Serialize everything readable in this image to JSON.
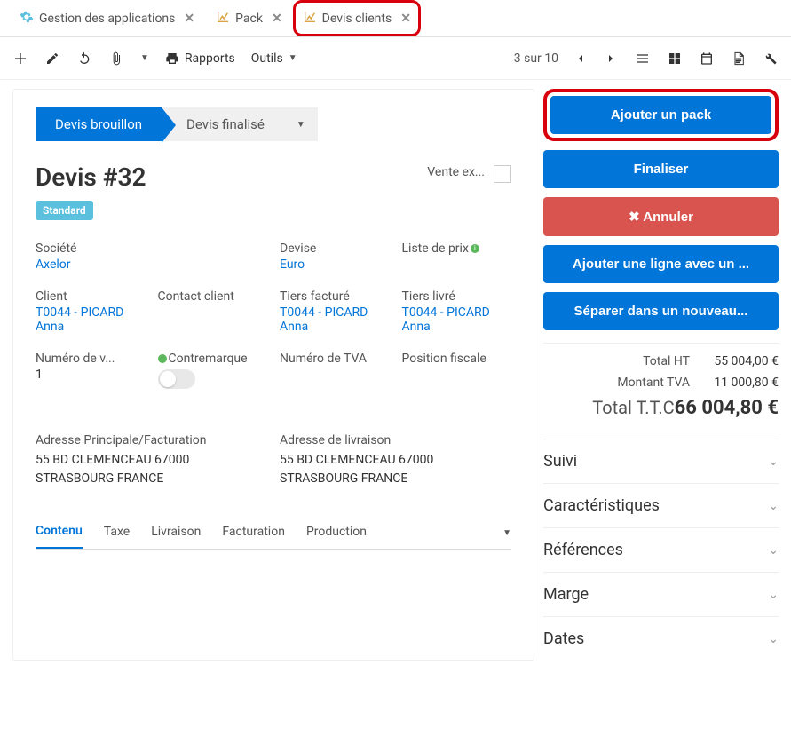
{
  "tabs": [
    {
      "label": "Gestion des applications",
      "icon": "gear"
    },
    {
      "label": "Pack",
      "icon": "chart"
    },
    {
      "label": "Devis clients",
      "icon": "chart",
      "highlighted": true
    }
  ],
  "toolbar": {
    "reports": "Rapports",
    "tools": "Outils",
    "pager": "3 sur 10"
  },
  "status": {
    "active": "Devis brouillon",
    "next": "Devis finalisé"
  },
  "title": "Devis #32",
  "badge": "Standard",
  "vente_ex": "Vente ex...",
  "fields": {
    "societe": {
      "label": "Société",
      "value": "Axelor"
    },
    "devise": {
      "label": "Devise",
      "value": "Euro"
    },
    "liste_prix": {
      "label": "Liste de prix"
    },
    "client": {
      "label": "Client",
      "value": "T0044 - PICARD Anna"
    },
    "contact_client": {
      "label": "Contact client"
    },
    "tiers_facture": {
      "label": "Tiers facturé",
      "value": "T0044 - PICARD Anna"
    },
    "tiers_livre": {
      "label": "Tiers livré",
      "value": "T0044 - PICARD Anna"
    },
    "numero_v": {
      "label": "Numéro de v...",
      "value": "1"
    },
    "contremarque": {
      "label": "Contremarque"
    },
    "numero_tva": {
      "label": "Numéro de TVA"
    },
    "position_fiscale": {
      "label": "Position fiscale"
    }
  },
  "addresses": {
    "facturation": {
      "label": "Adresse Principale/Facturation",
      "line1": "55 BD CLEMENCEAU 67000",
      "line2": "STRASBOURG FRANCE"
    },
    "livraison": {
      "label": "Adresse de livraison",
      "line1": "55 BD CLEMENCEAU 67000",
      "line2": "STRASBOURG FRANCE"
    }
  },
  "sub_tabs": [
    "Contenu",
    "Taxe",
    "Livraison",
    "Facturation",
    "Production"
  ],
  "actions": {
    "ajouter_pack": "Ajouter un pack",
    "finaliser": "Finaliser",
    "annuler": "Annuler",
    "ajouter_ligne": "Ajouter une ligne avec un ...",
    "separer": "Séparer dans un nouveau..."
  },
  "totals": {
    "ht": {
      "label": "Total HT",
      "value": "55 004,00 €"
    },
    "tva": {
      "label": "Montant TVA",
      "value": "11 000,80 €"
    },
    "ttc": {
      "label": "Total T.T.C",
      "value": "66 004,80 €"
    }
  },
  "collapsibles": [
    "Suivi",
    "Caractéristiques",
    "Références",
    "Marge",
    "Dates"
  ]
}
